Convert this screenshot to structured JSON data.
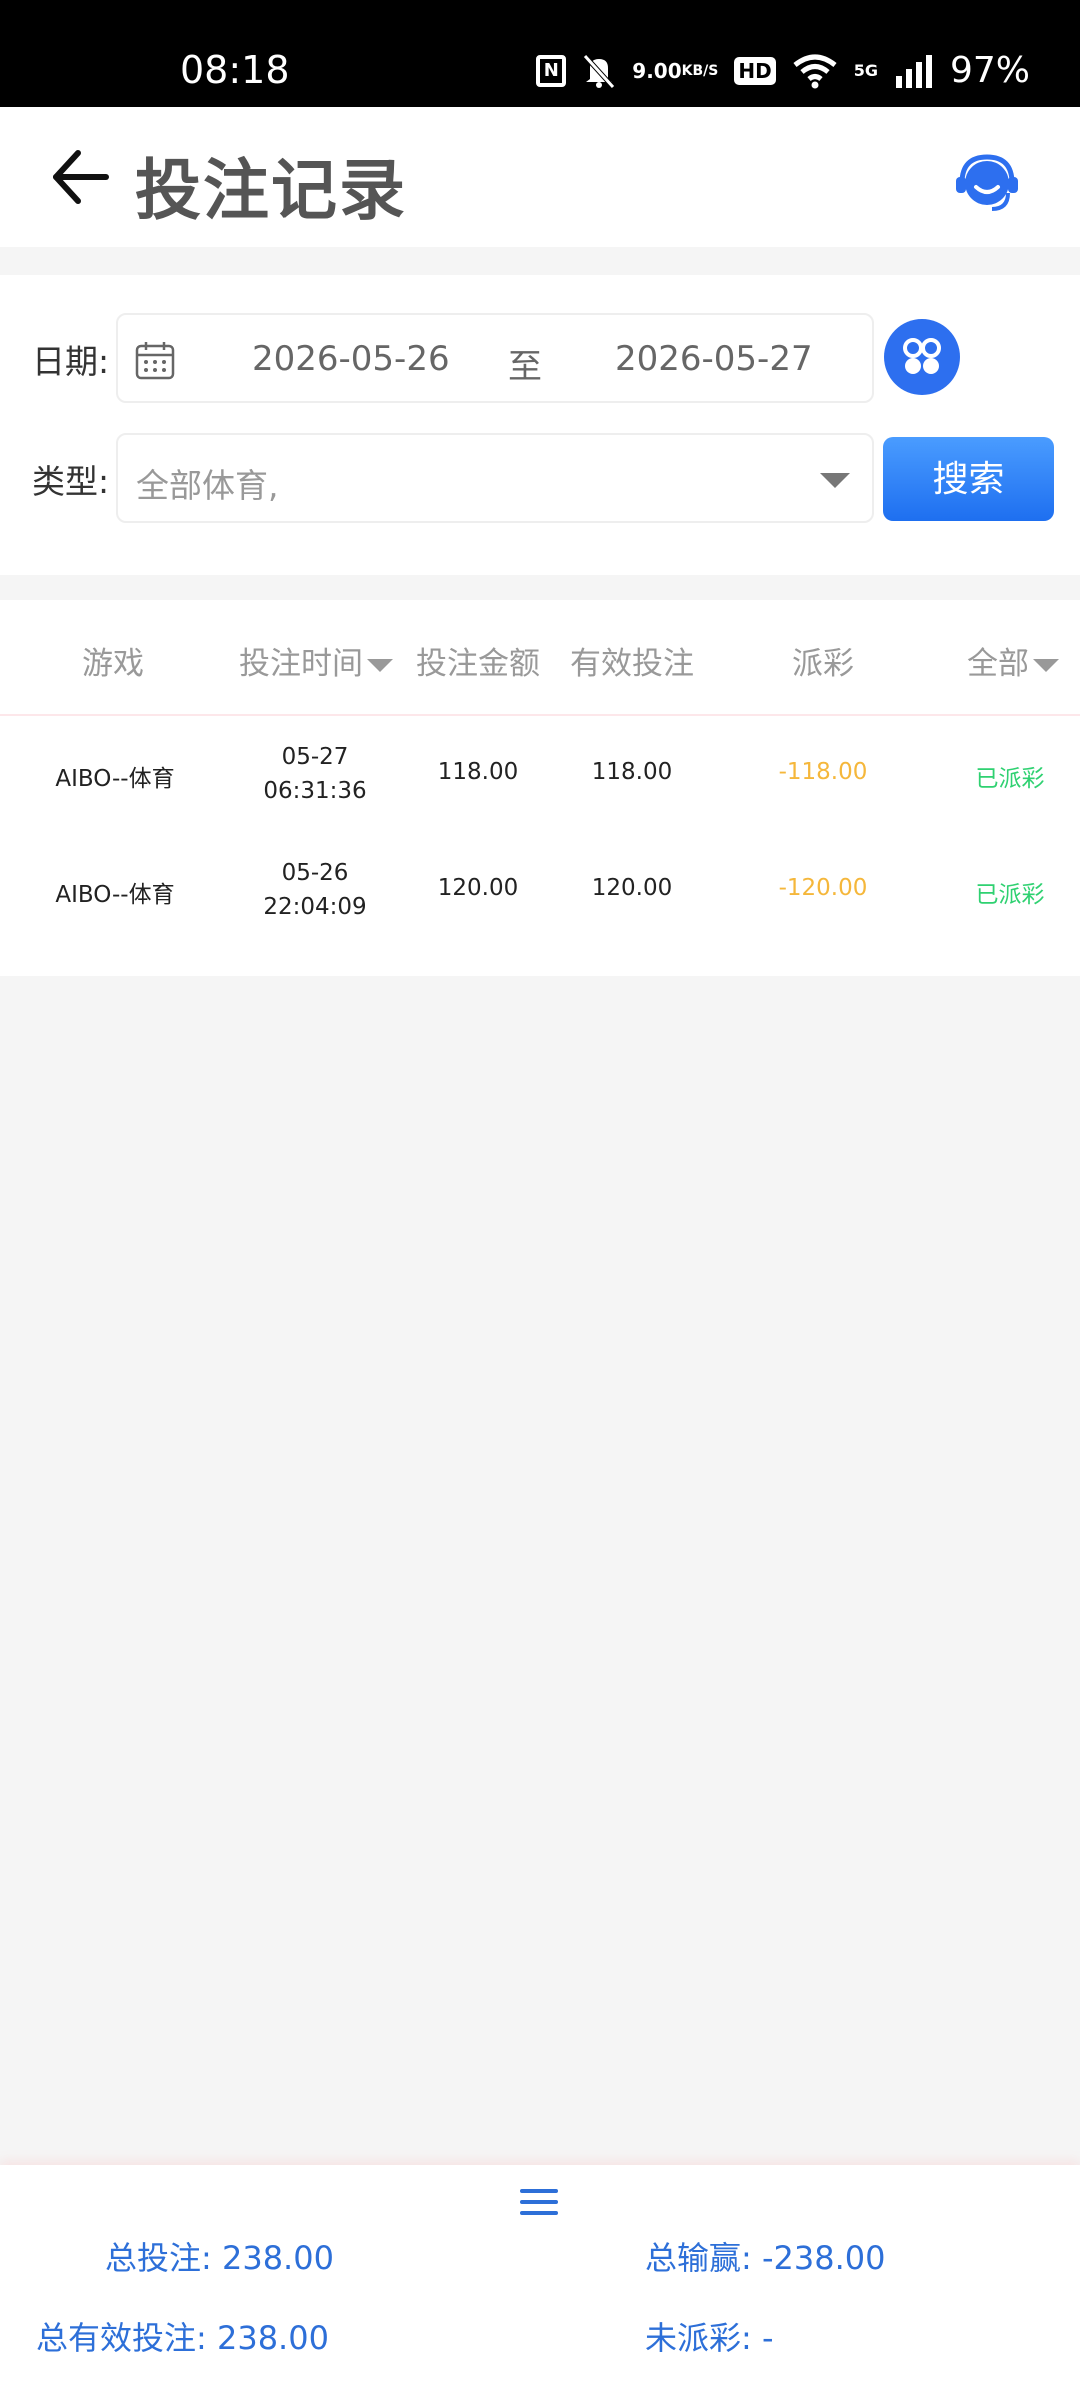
{
  "status_bar": {
    "time": "08:18",
    "speed_top": "9.00",
    "speed_unit": "KB/S",
    "hd": "HD",
    "network": "5G",
    "battery": "97%"
  },
  "header": {
    "title": "投注记录"
  },
  "filter": {
    "date_label": "日期:",
    "date_from": "2026-05-26",
    "date_sep": "至",
    "date_to": "2026-05-27",
    "type_label": "类型:",
    "type_value": "全部体育,",
    "search_label": "搜索"
  },
  "table": {
    "columns": [
      "游戏",
      "投注时间",
      "投注金额",
      "有效投注",
      "派彩",
      "全部"
    ],
    "rows": [
      {
        "game": "AIBO--体育",
        "date": "05-27",
        "time": "06:31:36",
        "amount": "118.00",
        "valid": "118.00",
        "payout": "-118.00",
        "status": "已派彩"
      },
      {
        "game": "AIBO--体育",
        "date": "05-26",
        "time": "22:04:09",
        "amount": "120.00",
        "valid": "120.00",
        "payout": "-120.00",
        "status": "已派彩"
      }
    ]
  },
  "summary": {
    "total_bet_label": "总投注:",
    "total_bet": "238.00",
    "total_winloss_label": "总输赢:",
    "total_winloss": "-238.00",
    "total_valid_label": "总有效投注:",
    "total_valid": "238.00",
    "unsettled_label": "未派彩:",
    "unsettled": "-"
  },
  "colors": {
    "accent": "#2d6fef",
    "payout_negative": "#f5b73b",
    "settled": "#2fd171",
    "summary_text": "#2d6fd8"
  }
}
